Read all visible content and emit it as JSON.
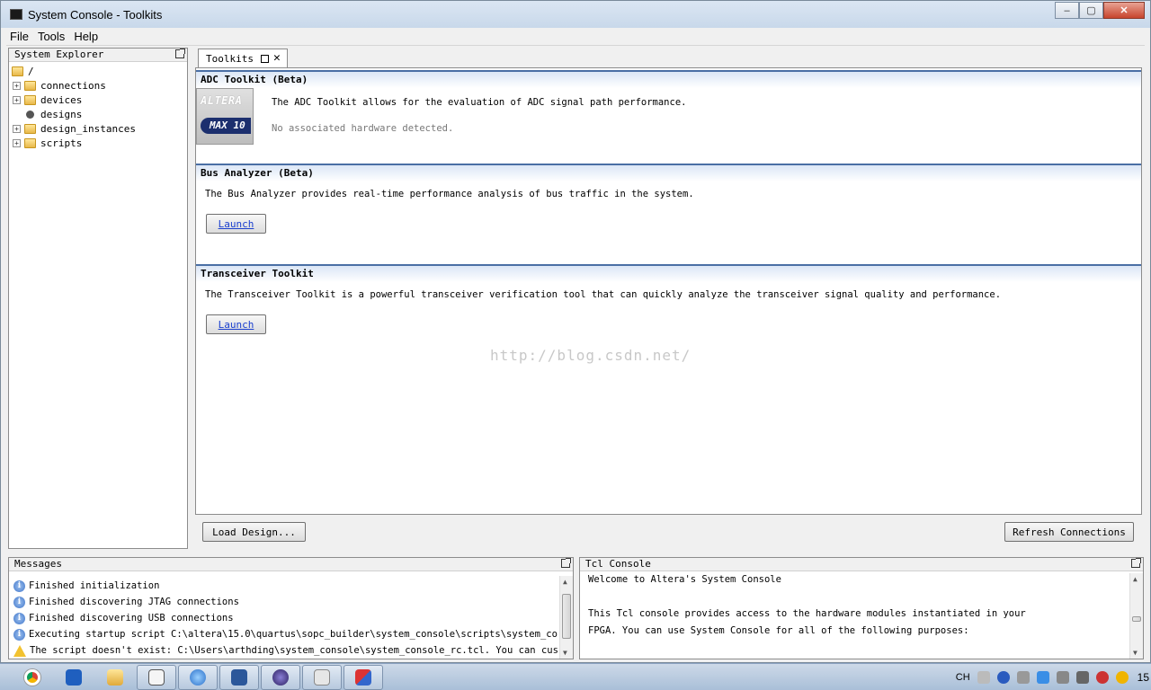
{
  "window": {
    "title": "System Console - Toolkits"
  },
  "menu": [
    "File",
    "Tools",
    "Help"
  ],
  "system_explorer": {
    "title": "System Explorer",
    "root": "/",
    "items": [
      {
        "label": "connections",
        "type": "folder",
        "expandable": true
      },
      {
        "label": "devices",
        "type": "folder",
        "expandable": true
      },
      {
        "label": "designs",
        "type": "designs",
        "expandable": false
      },
      {
        "label": "design_instances",
        "type": "folder",
        "expandable": true
      },
      {
        "label": "scripts",
        "type": "folder",
        "expandable": true
      }
    ]
  },
  "toolkits_tab": {
    "label": "Toolkits"
  },
  "toolkits": {
    "adc": {
      "title": "ADC Toolkit (Beta)",
      "desc": "The ADC Toolkit allows for the evaluation of ADC signal path performance.",
      "status": "No associated hardware detected.",
      "logo_top": "ALTERA",
      "logo_bottom": "MAX 10"
    },
    "bus": {
      "title": "Bus Analyzer (Beta)",
      "desc": "The Bus Analyzer provides real-time performance analysis of bus traffic in the system.",
      "launch": "Launch"
    },
    "xcvr": {
      "title": "Transceiver Toolkit",
      "desc": "The Transceiver Toolkit is a powerful transceiver verification tool that can quickly analyze the transceiver signal quality and performance.",
      "launch": "Launch"
    },
    "watermark": "http://blog.csdn.net/"
  },
  "buttons": {
    "load_design": "Load Design...",
    "refresh": "Refresh Connections"
  },
  "messages": {
    "title": "Messages",
    "items": [
      {
        "type": "info",
        "text": "Finished initialization"
      },
      {
        "type": "info",
        "text": "Finished discovering JTAG connections"
      },
      {
        "type": "info",
        "text": "Finished discovering USB connections"
      },
      {
        "type": "info",
        "text": "Executing startup script C:\\altera\\15.0\\quartus\\sopc_builder\\system_console\\scripts\\system_co..."
      },
      {
        "type": "warning",
        "text": "The script doesn't exist: C:\\Users\\arthding\\system_console\\system_console_rc.tcl. You can cus..."
      }
    ]
  },
  "tcl": {
    "title": "Tcl Console",
    "lines": [
      "Welcome to Altera's System Console",
      "",
      "This Tcl console provides access to the hardware modules instantiated in your",
      "FPGA. You can use System Console for all of the following purposes:"
    ]
  },
  "taskbar": {
    "apps": [
      "chrome-icon",
      "outlook-icon",
      "explorer-icon",
      "console-icon",
      "globe-icon",
      "word-icon",
      "eclipse-icon",
      "clipboard-icon",
      "tool-icon"
    ],
    "tray_text": "CH",
    "clock": "15"
  },
  "colors": {
    "section_border": "#4a6fa5",
    "link": "#1a3fcf"
  }
}
